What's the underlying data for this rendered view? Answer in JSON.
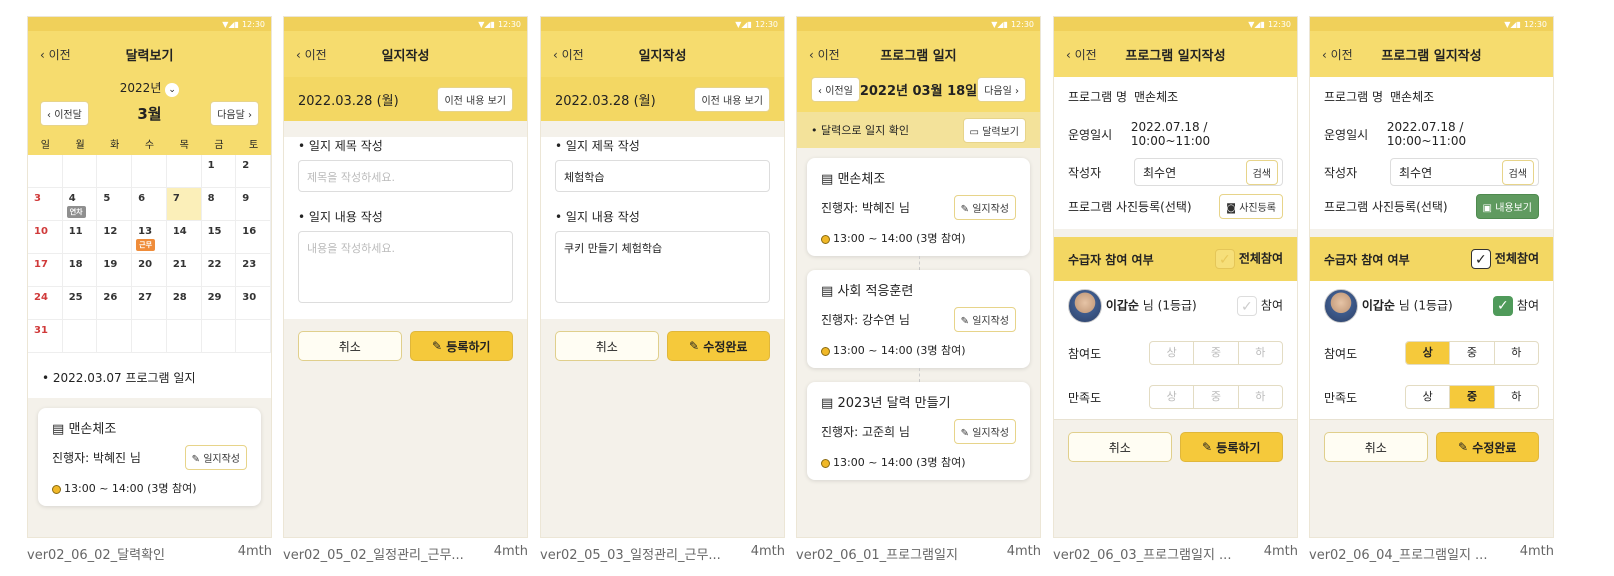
{
  "status_time": "12:30",
  "back_label": "이전",
  "screens": [
    {
      "title": "달력보기",
      "caption": "ver02_06_02_달력확인",
      "age": "4mth",
      "year": "2022년",
      "prev_month": "이전달",
      "month": "3월",
      "next_month": "다음달",
      "weekdays": [
        "일",
        "월",
        "화",
        "수",
        "목",
        "금",
        "토"
      ],
      "days": [
        "",
        "",
        "",
        "",
        "",
        "1",
        "2",
        "3",
        "4",
        "5",
        "6",
        "7",
        "8",
        "9",
        "10",
        "11",
        "12",
        "13",
        "14",
        "15",
        "16",
        "17",
        "18",
        "19",
        "20",
        "21",
        "22",
        "23",
        "24",
        "25",
        "26",
        "27",
        "28",
        "29",
        "30",
        "31",
        "",
        "",
        "",
        "",
        "",
        ""
      ],
      "tag_leave": "연차",
      "tag_work": "근무",
      "log_heading": "2022.03.07  프로그램 일지",
      "program": {
        "name": "맨손체조",
        "leader": "진행자: 박혜진 님",
        "button": "일지작성",
        "time": "13:00 ~ 14:00 (3명 참여)"
      }
    },
    {
      "title": "일지작성",
      "caption": "ver02_05_02_일정관리_근무...",
      "age": "4mth",
      "date": "2022.03.28 (월)",
      "prev_btn": "이전 내용 보기",
      "title_label": "일지 제목 작성",
      "title_placeholder": "제목을 작성하세요.",
      "content_label": "일지 내용 작성",
      "content_placeholder": "내용을 작성하세요.",
      "cancel": "취소",
      "submit": "등록하기"
    },
    {
      "title": "일지작성",
      "caption": "ver02_05_03_일정관리_근무...",
      "age": "4mth",
      "date": "2022.03.28 (월)",
      "prev_btn": "이전 내용 보기",
      "title_label": "일지 제목 작성",
      "title_value": "체험학습",
      "content_label": "일지 내용 작성",
      "content_value": "쿠키 만들기 체험학습",
      "cancel": "취소",
      "submit": "수정완료"
    },
    {
      "title": "프로그램 일지",
      "caption": "ver02_06_01_프로그램일지",
      "age": "4mth",
      "prev_day": "이전일",
      "date": "2022년 03월 18일",
      "next_day": "다음일",
      "cal_check": "달력으로 일지 확인",
      "cal_btn": "달력보기",
      "programs": [
        {
          "name": "맨손체조",
          "leader": "진행자: 박혜진 님",
          "button": "일지작성",
          "time": "13:00 ~ 14:00 (3명 참여)"
        },
        {
          "name": "사회 적응훈련",
          "leader": "진행자: 강수연 님",
          "button": "일지작성",
          "time": "13:00 ~ 14:00 (3명 참여)"
        },
        {
          "name": "2023년 달력 만들기",
          "leader": "진행자: 고준희 님",
          "button": "일지작성",
          "time": "13:00 ~ 14:00 (3명 참여)"
        }
      ]
    },
    {
      "title": "프로그램 일지작성",
      "caption": "ver02_06_03_프로그램일지 ...",
      "age": "4mth",
      "prog_label": "프로그램 명",
      "prog_value": "맨손체조",
      "op_label": "운영일시",
      "op_value": "2022.07.18 / 10:00~11:00",
      "author_label": "작성자",
      "author_value": "최수연",
      "search": "검색",
      "photo_label": "프로그램 사진등록(선택)",
      "photo_btn": "사진등록",
      "part_label": "수급자 참여 여부",
      "all_part": "전체참여",
      "person": "이갑순",
      "person_suffix": "님 (1등급)",
      "part": "참여",
      "degree_label": "참여도",
      "sat_label": "만족도",
      "levels": [
        "상",
        "중",
        "하"
      ],
      "cancel": "취소",
      "submit": "등록하기"
    },
    {
      "title": "프로그램 일지작성",
      "caption": "ver02_06_04_프로그램일지 ...",
      "age": "4mth",
      "prog_label": "프로그램 명",
      "prog_value": "맨손체조",
      "op_label": "운영일시",
      "op_value": "2022.07.18 / 10:00~11:00",
      "author_label": "작성자",
      "author_value": "최수연",
      "search": "검색",
      "photo_label": "프로그램 사진등록(선택)",
      "photo_btn": "내용보기",
      "part_label": "수급자 참여 여부",
      "all_part": "전체참여",
      "person": "이갑순",
      "person_suffix": "님 (1등급)",
      "part": "참여",
      "degree_label": "참여도",
      "sat_label": "만족도",
      "levels": [
        "상",
        "중",
        "하"
      ],
      "degree_selected": "상",
      "sat_selected": "중",
      "cancel": "취소",
      "submit": "수정완료"
    }
  ]
}
